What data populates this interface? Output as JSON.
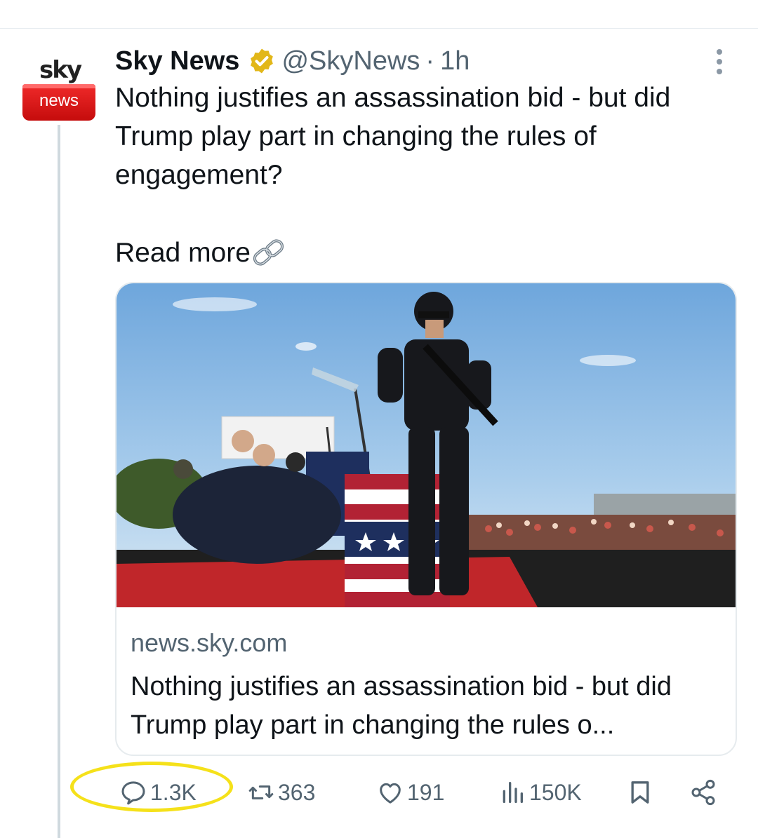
{
  "tweet": {
    "avatar": {
      "top_text": "sky",
      "bottom_text": "news",
      "brand_red": "#e10a0a"
    },
    "display_name": "Sky News",
    "verified_badge": "gold-verified-icon",
    "handle": "@SkyNews",
    "separator": "·",
    "time": "1h",
    "text": "Nothing justifies an assassination bid - but did Trump play part in changing the rules of engagement?",
    "read_more": "Read more",
    "link_icon": "link-chain-icon"
  },
  "card": {
    "image_alt": "Armed security officer stands on a rally stage while agents cover a figure near the podium",
    "domain": "news.sky.com",
    "title": "Nothing justifies an assassination bid - but did Trump play part in changing the rules o..."
  },
  "actions": {
    "replies": "1.3K",
    "reposts": "363",
    "likes": "191",
    "views": "150K",
    "highlight_color": "#f5e11a"
  },
  "colors": {
    "text": "#0f1419",
    "secondary": "#536471",
    "verified_gold": "#e2b719"
  }
}
